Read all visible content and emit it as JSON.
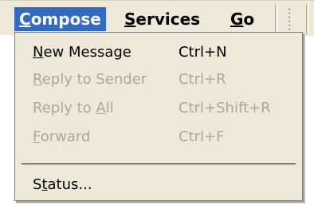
{
  "menubar": {
    "items": [
      {
        "pre": "",
        "accel": "C",
        "post": "ompose"
      },
      {
        "pre": "",
        "accel": "S",
        "post": "ervices"
      },
      {
        "pre": "",
        "accel": "G",
        "post": "o"
      }
    ]
  },
  "dropdown": {
    "items": [
      {
        "pre": "",
        "accel": "N",
        "post": "ew Message",
        "shortcut": "Ctrl+N",
        "enabled": true
      },
      {
        "pre": "",
        "accel": "R",
        "post": "eply to Sender",
        "shortcut": "Ctrl+R",
        "enabled": false
      },
      {
        "pre": "Reply to ",
        "accel": "A",
        "post": "ll",
        "shortcut": "Ctrl+Shift+R",
        "enabled": false
      },
      {
        "pre": "",
        "accel": "F",
        "post": "orward",
        "shortcut": "Ctrl+F",
        "enabled": false
      },
      {
        "pre": "S",
        "accel": "t",
        "post": "atus...",
        "shortcut": "",
        "enabled": true
      }
    ]
  },
  "colors": {
    "menu_background": "#ece9d8",
    "active_highlight": "#316ac5",
    "disabled_text": "#aca899"
  }
}
